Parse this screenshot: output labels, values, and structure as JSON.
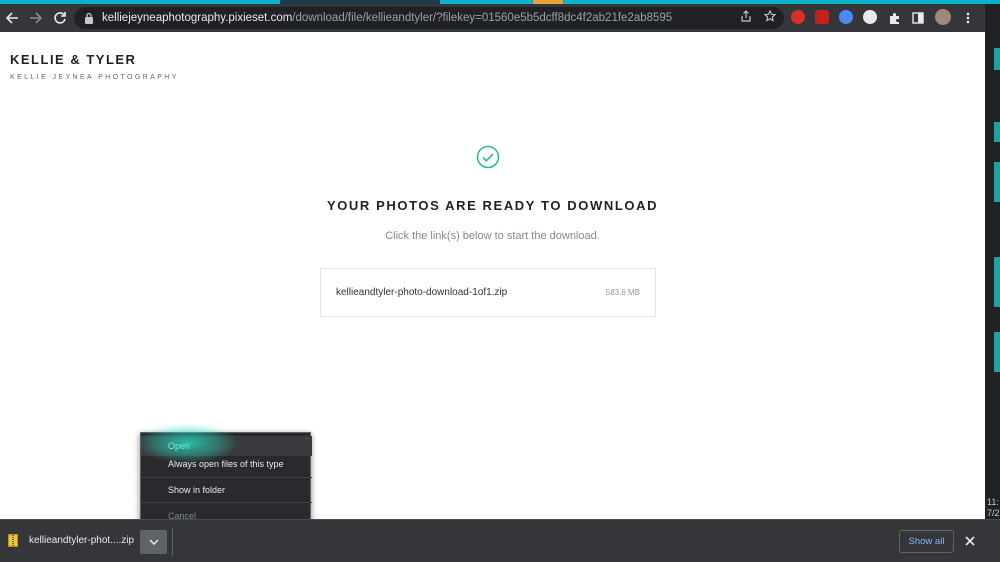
{
  "browser": {
    "url_host": "kelliejeyneaphotography.pixieset.com",
    "url_path": "/download/file/kellieandtyler/?filekey=01560e5b5dcff8dc4f2ab21fe2ab8595"
  },
  "page": {
    "brand_title": "KELLIE & TYLER",
    "brand_subtitle": "KELLIE JEYNEA PHOTOGRAPHY",
    "headline": "YOUR PHOTOS ARE READY TO DOWNLOAD",
    "subline": "Click the link(s) below to start the download.",
    "file": {
      "name": "kellieandtyler-photo-download-1of1.zip",
      "size": "583.6 MB"
    }
  },
  "context_menu": {
    "items": [
      {
        "label": "Open",
        "state": "hover"
      },
      {
        "label": "Always open files of this type",
        "state": "normal"
      },
      {
        "label": "Show in folder",
        "state": "normal"
      },
      {
        "label": "Cancel",
        "state": "disabled"
      }
    ]
  },
  "download_shelf": {
    "item_name": "kellieandtyler-phot....zip",
    "show_all": "Show all"
  },
  "taskbar_edge": {
    "time_fragment": "11:",
    "date_fragment": "7/2"
  },
  "colors": {
    "accent_teal": "#19a3a6",
    "check_green": "#2bb59a",
    "link_blue": "#8ab4f8"
  },
  "icons": [
    "back-icon",
    "forward-icon",
    "reload-icon",
    "lock-icon",
    "share-icon",
    "star-icon",
    "puzzle-icon",
    "sidepanel-icon",
    "menu-icon",
    "check-circle-icon",
    "zip-file-icon",
    "chevron-down-icon",
    "close-icon"
  ]
}
